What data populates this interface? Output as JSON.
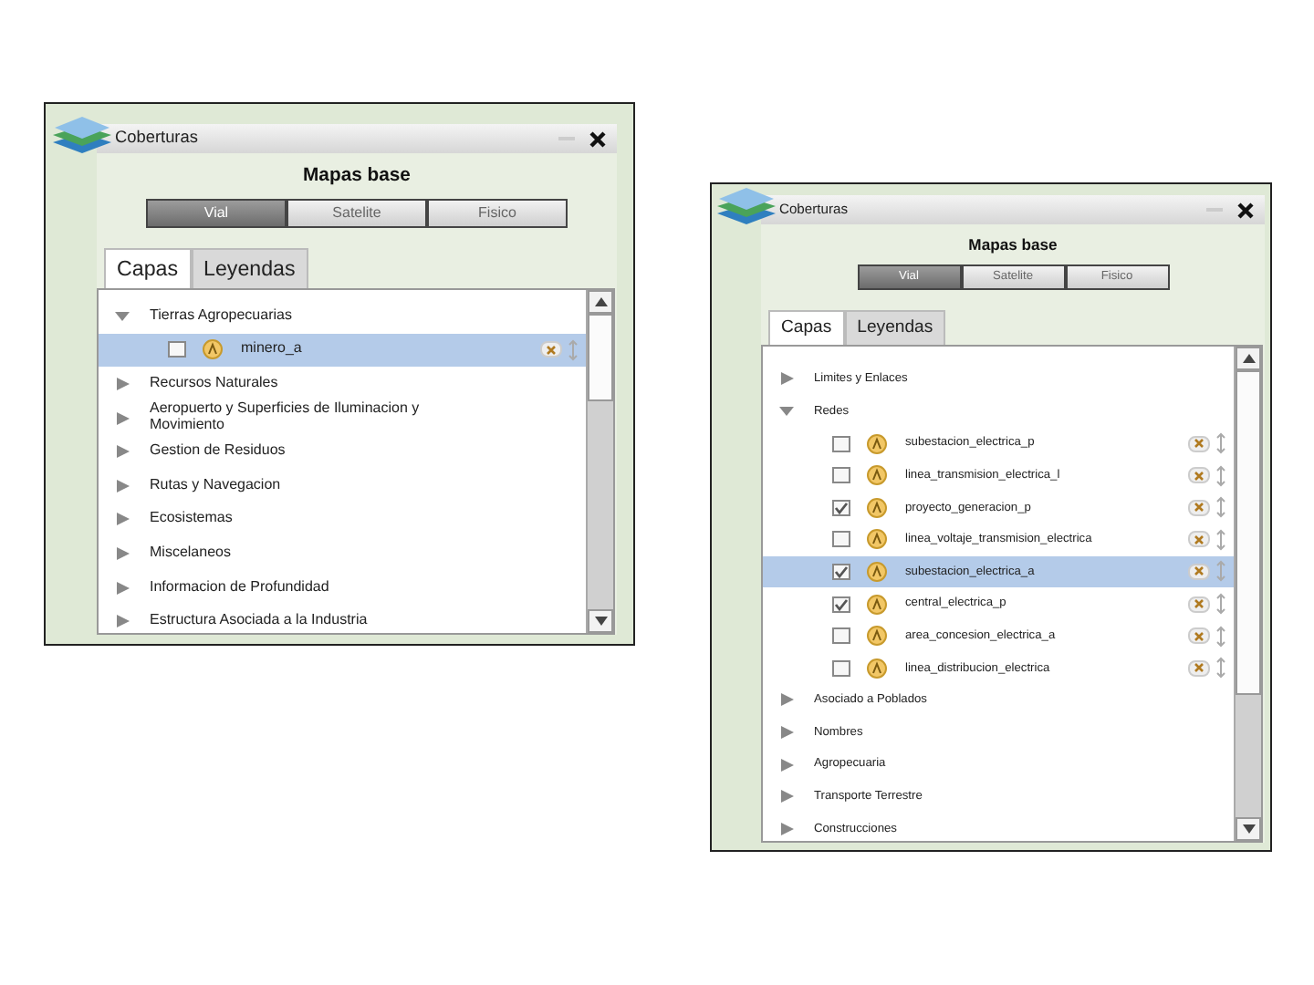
{
  "panels": [
    {
      "title": "Coberturas",
      "basemap_title": "Mapas base",
      "basemap_buttons": [
        {
          "label": "Vial",
          "selected": true
        },
        {
          "label": "Satelite",
          "selected": false
        },
        {
          "label": "Fisico",
          "selected": false
        }
      ],
      "tabs": [
        {
          "label": "Capas",
          "selected": true
        },
        {
          "label": "Leyendas",
          "selected": false
        }
      ],
      "layers": [
        {
          "label": "Tierras Agropecuarias",
          "expanded": true,
          "children": [
            {
              "label": "minero_a",
              "checked": false,
              "selected": true
            }
          ]
        },
        {
          "label": "Recursos Naturales",
          "expanded": false
        },
        {
          "label": "Aeropuerto y Superficies de Iluminacion y Movimiento",
          "expanded": false
        },
        {
          "label": "Gestion de Residuos",
          "expanded": false
        },
        {
          "label": "Rutas y Navegacion",
          "expanded": false
        },
        {
          "label": "Ecosistemas",
          "expanded": false
        },
        {
          "label": "Miscelaneos",
          "expanded": false
        },
        {
          "label": "Informacion de Profundidad",
          "expanded": false
        },
        {
          "label": "Estructura Asociada a la Industria",
          "expanded": false
        }
      ]
    },
    {
      "title": "Coberturas",
      "basemap_title": "Mapas base",
      "basemap_buttons": [
        {
          "label": "Vial",
          "selected": true
        },
        {
          "label": "Satelite",
          "selected": false
        },
        {
          "label": "Fisico",
          "selected": false
        }
      ],
      "tabs": [
        {
          "label": "Capas",
          "selected": true
        },
        {
          "label": "Leyendas",
          "selected": false
        }
      ],
      "layers": [
        {
          "label": "Limites y Enlaces",
          "expanded": false
        },
        {
          "label": "Redes",
          "expanded": true,
          "children": [
            {
              "label": "subestacion_electrica_p",
              "checked": false,
              "selected": false
            },
            {
              "label": "linea_transmision_electrica_l",
              "checked": false,
              "selected": false
            },
            {
              "label": "proyecto_generacion_p",
              "checked": true,
              "selected": false
            },
            {
              "label": "linea_voltaje_transmision_electrica",
              "checked": false,
              "selected": false
            },
            {
              "label": "subestacion_electrica_a",
              "checked": true,
              "selected": true
            },
            {
              "label": "central_electrica_p",
              "checked": true,
              "selected": false
            },
            {
              "label": "area_concesion_electrica_a",
              "checked": false,
              "selected": false
            },
            {
              "label": "linea_distribucion_electrica",
              "checked": false,
              "selected": false
            }
          ]
        },
        {
          "label": "Asociado a Poblados",
          "expanded": false
        },
        {
          "label": "Nombres",
          "expanded": false
        },
        {
          "label": "Agropecuaria",
          "expanded": false
        },
        {
          "label": "Transporte Terrestre",
          "expanded": false
        },
        {
          "label": "Construcciones",
          "expanded": false
        }
      ]
    }
  ]
}
